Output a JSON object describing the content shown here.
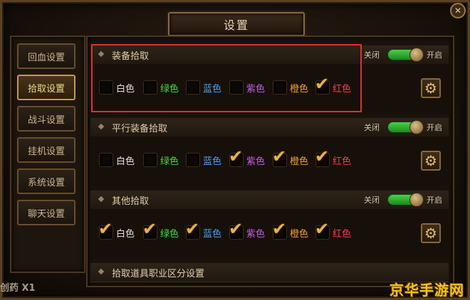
{
  "window": {
    "title": "设置",
    "close_icon": "close-icon"
  },
  "sidebar": {
    "tabs": [
      {
        "label": "回血设置",
        "active": false
      },
      {
        "label": "拾取设置",
        "active": true
      },
      {
        "label": "战斗设置",
        "active": false
      },
      {
        "label": "挂机设置",
        "active": false
      },
      {
        "label": "系统设置",
        "active": false
      },
      {
        "label": "聊天设置",
        "active": false
      }
    ]
  },
  "sections": [
    {
      "title": "装备拾取",
      "toggle": {
        "off_label": "关闭",
        "on_label": "开启",
        "on": true
      },
      "options": [
        {
          "label": "白色",
          "color": "#e8e0d0",
          "checked": false
        },
        {
          "label": "绿色",
          "color": "#3fdc3f",
          "checked": false
        },
        {
          "label": "蓝色",
          "color": "#4aa0f0",
          "checked": false
        },
        {
          "label": "紫色",
          "color": "#c25ce8",
          "checked": false
        },
        {
          "label": "橙色",
          "color": "#f0a030",
          "checked": false
        },
        {
          "label": "红色",
          "color": "#f04040",
          "checked": true
        }
      ]
    },
    {
      "title": "平行装备拾取",
      "toggle": {
        "off_label": "关闭",
        "on_label": "开启",
        "on": true
      },
      "options": [
        {
          "label": "白色",
          "color": "#e8e0d0",
          "checked": false
        },
        {
          "label": "绿色",
          "color": "#3fdc3f",
          "checked": false
        },
        {
          "label": "蓝色",
          "color": "#4aa0f0",
          "checked": false
        },
        {
          "label": "紫色",
          "color": "#c25ce8",
          "checked": true
        },
        {
          "label": "橙色",
          "color": "#f0a030",
          "checked": true
        },
        {
          "label": "红色",
          "color": "#f04040",
          "checked": true
        }
      ]
    },
    {
      "title": "其他拾取",
      "toggle": {
        "off_label": "关闭",
        "on_label": "开启",
        "on": true
      },
      "options": [
        {
          "label": "白色",
          "color": "#e8e0d0",
          "checked": true
        },
        {
          "label": "绿色",
          "color": "#3fdc3f",
          "checked": true
        },
        {
          "label": "蓝色",
          "color": "#4aa0f0",
          "checked": true
        },
        {
          "label": "紫色",
          "color": "#c25ce8",
          "checked": true
        },
        {
          "label": "橙色",
          "color": "#f0a030",
          "checked": true
        },
        {
          "label": "红色",
          "color": "#f04040",
          "checked": true
        }
      ]
    },
    {
      "title": "拾取道具职业区分设置"
    }
  ],
  "footer": {
    "item_text": "创药 X1",
    "watermark": "京华手游网"
  },
  "colors": {
    "highlight_box": "#e03030",
    "check_mark": "#e8b34c",
    "toggle_green": "#3cc83c"
  }
}
